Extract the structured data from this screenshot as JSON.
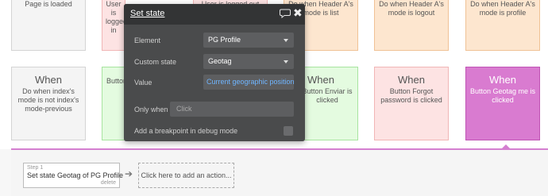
{
  "cards_row1": [
    {
      "text": "Page is loaded"
    },
    {
      "text": "User is logged in"
    },
    {
      "text": "User is logged out"
    },
    {
      "text": "Do when Header A's mode is list"
    },
    {
      "text": "Do when Header A's mode is logout"
    },
    {
      "text": "Do when Header A's mode is profile"
    }
  ],
  "cards_row2": [
    {
      "when": "When",
      "text": "Do when index's mode is not index's mode-previous"
    },
    {
      "when": "",
      "text": "Button"
    },
    {
      "when": "When",
      "text": "Button Enviar is clicked"
    },
    {
      "when": "When",
      "text": "Button Forgot password is clicked"
    },
    {
      "when": "When",
      "text": "Button Geotag me is clicked"
    }
  ],
  "popup": {
    "title": "Set state",
    "close_glyph": "✖",
    "element_label": "Element",
    "element_value": "PG Profile",
    "custom_state_label": "Custom state",
    "custom_state_value": "Geotag",
    "value_label": "Value",
    "value_value": "Current geographic position",
    "only_when_label": "Only when",
    "only_when_placeholder": "Click",
    "breakpoint_label": "Add a breakpoint in debug mode"
  },
  "actions": {
    "step_label": "Step 1",
    "step_text": "Set state Geotag of PG Profile",
    "step_delete": "delete",
    "arrow_glyph": "➔",
    "add_action": "Click here to add an action..."
  },
  "colors": {
    "grey": "#f4f4f4",
    "pink": "#fde3e3",
    "orange": "#fde6cf",
    "green": "#e4fbe0",
    "magenta_selected": "#d97bd0",
    "popup_bg": "#4a4b4c",
    "value_link": "#6fb5ff"
  },
  "icons": {
    "comment": "comment-icon",
    "close": "close-icon",
    "arrow": "arrow-right-icon",
    "dropdown": "chevron-down-icon"
  }
}
